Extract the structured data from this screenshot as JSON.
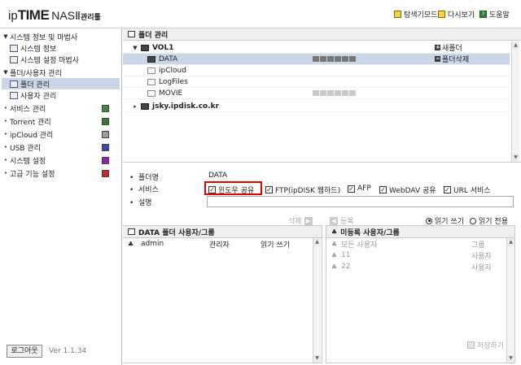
{
  "header": {
    "logo_ip": "ip",
    "logo_time": "TIME",
    "logo_nas": "NASⅡ",
    "logo_mgr": "관리툴",
    "explorer_mode": "탐색기모드",
    "reload": "다시보기",
    "help": "도움말"
  },
  "sidebar": {
    "groups": [
      {
        "label": "시스템 정보 및 마법사",
        "expanded": true
      },
      {
        "label": "폴더/사용자 관리",
        "expanded": true
      }
    ],
    "system_items": [
      "시스템 정보",
      "시스템 설정 마법사"
    ],
    "folder_items": [
      "폴더 관리",
      "사용자 관리"
    ],
    "other_items": [
      "서비스 관리",
      "Torrent 관리",
      "ipCloud 관리",
      "USB 관리",
      "시스템 설정",
      "고급 기능 설정"
    ],
    "logout": "로그아웃",
    "version": "Ver 1.1.34"
  },
  "folder_panel": {
    "title": "폴더 관리",
    "volume": "VOL1",
    "folders": [
      "DATA",
      "ipCloud",
      "LogFiles",
      "MOVIE"
    ],
    "remote": "jsky.ipdisk.co.kr",
    "new_folder": "새폴더",
    "delete_folder": "폴더삭제"
  },
  "details": {
    "folder_name_label": "폴더명",
    "folder_name_value": "DATA",
    "service_label": "서비스",
    "desc_label": "설명",
    "services": [
      "윈도우 공유",
      "FTP(ipDISK 웹하드)",
      "AFP",
      "WebDAV 공유",
      "URL 서비스"
    ]
  },
  "move": {
    "delete": "삭제",
    "register": "등록"
  },
  "permission": {
    "read_write": "읽기 쓰기",
    "read_only": "읽기 전용"
  },
  "users_panel": {
    "title": "DATA 폴더 사용자/그룹",
    "rows": [
      {
        "name": "admin",
        "role": "관리자",
        "perm": "읽기 쓰기"
      }
    ]
  },
  "unreg_panel": {
    "title": "미등록 사용자/그룹",
    "rows": [
      {
        "name": "모든 사용자",
        "type": "그룹"
      },
      {
        "name": "11",
        "type": "사용자"
      },
      {
        "name": "22",
        "type": "사용자"
      }
    ]
  },
  "save": "저장하기"
}
